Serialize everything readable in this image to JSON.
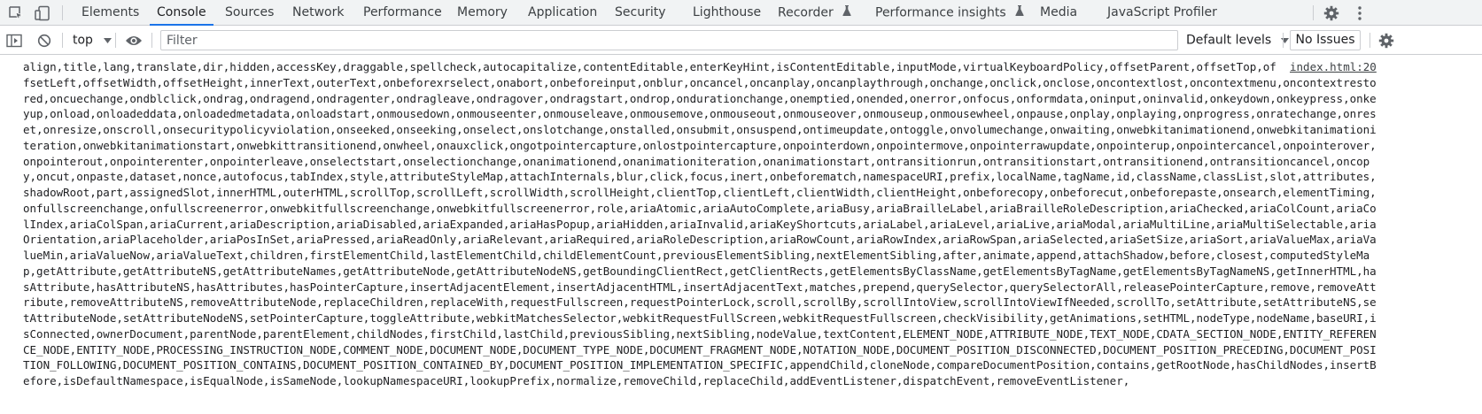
{
  "tabbar": {
    "inspect_icon": "select-element-icon",
    "device_icon": "device-toolbar-icon",
    "tabs": [
      {
        "label": "Elements"
      },
      {
        "label": "Console"
      },
      {
        "label": "Sources"
      },
      {
        "label": "Network"
      },
      {
        "label": "Performance"
      },
      {
        "label": "Memory"
      },
      {
        "label": "Application"
      },
      {
        "label": "Security"
      },
      {
        "label": "Lighthouse"
      },
      {
        "label": "Recorder"
      },
      {
        "label": "Performance insights"
      },
      {
        "label": "Media"
      },
      {
        "label": "JavaScript Profiler"
      }
    ],
    "active_tab": "Console",
    "settings_icon": "gear-icon",
    "more_icon": "kebab-menu-icon"
  },
  "toolbar": {
    "sidebar_icon": "show-sidebar-icon",
    "clear_icon": "clear-console-icon",
    "context": "top",
    "eye_icon": "live-expression-icon",
    "filter_placeholder": "Filter",
    "filter_value": "",
    "levels_label": "Default levels",
    "issues_label": "No Issues",
    "settings_icon": "gear-icon"
  },
  "console": {
    "source_link": "index.html:20",
    "message": "align,title,lang,translate,dir,hidden,accessKey,draggable,spellcheck,autocapitalize,contentEditable,enterKeyHint,isContentEditable,inputMode,virtualKeyboardPolicy,offsetParent,offsetTop,offsetLeft,offsetWidth,offsetHeight,innerText,outerText,onbeforexrselect,onabort,onbeforeinput,onblur,oncancel,oncanplay,oncanplaythrough,onchange,onclick,onclose,oncontextlost,oncontextmenu,oncontextrestored,oncuechange,ondblclick,ondrag,ondragend,ondragenter,ondragleave,ondragover,ondragstart,ondrop,ondurationchange,onemptied,onended,onerror,onfocus,onformdata,oninput,oninvalid,onkeydown,onkeypress,onkeyup,onload,onloadeddata,onloadedmetadata,onloadstart,onmousedown,onmouseenter,onmouseleave,onmousemove,onmouseout,onmouseover,onmouseup,onmousewheel,onpause,onplay,onplaying,onprogress,onratechange,onreset,onresize,onscroll,onsecuritypolicyviolation,onseeked,onseeking,onselect,onslotchange,onstalled,onsubmit,onsuspend,ontimeupdate,ontoggle,onvolumechange,onwaiting,onwebkitanimationend,onwebkitanimationiteration,onwebkitanimationstart,onwebkittransitionend,onwheel,onauxclick,ongotpointercapture,onlostpointercapture,onpointerdown,onpointermove,onpointerrawupdate,onpointerup,onpointercancel,onpointerover,onpointerout,onpointerenter,onpointerleave,onselectstart,onselectionchange,onanimationend,onanimationiteration,onanimationstart,ontransitionrun,ontransitionstart,ontransitionend,ontransitioncancel,oncopy,oncut,onpaste,dataset,nonce,autofocus,tabIndex,style,attributeStyleMap,attachInternals,blur,click,focus,inert,onbeforematch,namespaceURI,prefix,localName,tagName,id,className,classList,slot,attributes,shadowRoot,part,assignedSlot,innerHTML,outerHTML,scrollTop,scrollLeft,scrollWidth,scrollHeight,clientTop,clientLeft,clientWidth,clientHeight,onbeforecopy,onbeforecut,onbeforepaste,onsearch,elementTiming,onfullscreenchange,onfullscreenerror,onwebkitfullscreenchange,onwebkitfullscreenerror,role,ariaAtomic,ariaAutoComplete,ariaBusy,ariaBrailleLabel,ariaBrailleRoleDescription,ariaChecked,ariaColCount,ariaColIndex,ariaColSpan,ariaCurrent,ariaDescription,ariaDisabled,ariaExpanded,ariaHasPopup,ariaHidden,ariaInvalid,ariaKeyShortcuts,ariaLabel,ariaLevel,ariaLive,ariaModal,ariaMultiLine,ariaMultiSelectable,ariaOrientation,ariaPlaceholder,ariaPosInSet,ariaPressed,ariaReadOnly,ariaRelevant,ariaRequired,ariaRoleDescription,ariaRowCount,ariaRowIndex,ariaRowSpan,ariaSelected,ariaSetSize,ariaSort,ariaValueMax,ariaValueMin,ariaValueNow,ariaValueText,children,firstElementChild,lastElementChild,childElementCount,previousElementSibling,nextElementSibling,after,animate,append,attachShadow,before,closest,computedStyleMap,getAttribute,getAttributeNS,getAttributeNames,getAttributeNode,getAttributeNodeNS,getBoundingClientRect,getClientRects,getElementsByClassName,getElementsByTagName,getElementsByTagNameNS,getInnerHTML,hasAttribute,hasAttributeNS,hasAttributes,hasPointerCapture,insertAdjacentElement,insertAdjacentHTML,insertAdjacentText,matches,prepend,querySelector,querySelectorAll,releasePointerCapture,remove,removeAttribute,removeAttributeNS,removeAttributeNode,replaceChildren,replaceWith,requestFullscreen,requestPointerLock,scroll,scrollBy,scrollIntoView,scrollIntoViewIfNeeded,scrollTo,setAttribute,setAttributeNS,setAttributeNode,setAttributeNodeNS,setPointerCapture,toggleAttribute,webkitMatchesSelector,webkitRequestFullScreen,webkitRequestFullscreen,checkVisibility,getAnimations,setHTML,nodeType,nodeName,baseURI,isConnected,ownerDocument,parentNode,parentElement,childNodes,firstChild,lastChild,previousSibling,nextSibling,nodeValue,textContent,ELEMENT_NODE,ATTRIBUTE_NODE,TEXT_NODE,CDATA_SECTION_NODE,ENTITY_REFERENCE_NODE,ENTITY_NODE,PROCESSING_INSTRUCTION_NODE,COMMENT_NODE,DOCUMENT_NODE,DOCUMENT_TYPE_NODE,DOCUMENT_FRAGMENT_NODE,NOTATION_NODE,DOCUMENT_POSITION_DISCONNECTED,DOCUMENT_POSITION_PRECEDING,DOCUMENT_POSITION_FOLLOWING,DOCUMENT_POSITION_CONTAINS,DOCUMENT_POSITION_CONTAINED_BY,DOCUMENT_POSITION_IMPLEMENTATION_SPECIFIC,appendChild,cloneNode,compareDocumentPosition,contains,getRootNode,hasChildNodes,insertBefore,isDefaultNamespace,isEqualNode,isSameNode,lookupNamespaceURI,lookupPrefix,normalize,removeChild,replaceChild,addEventListener,dispatchEvent,removeEventListener,"
  }
}
